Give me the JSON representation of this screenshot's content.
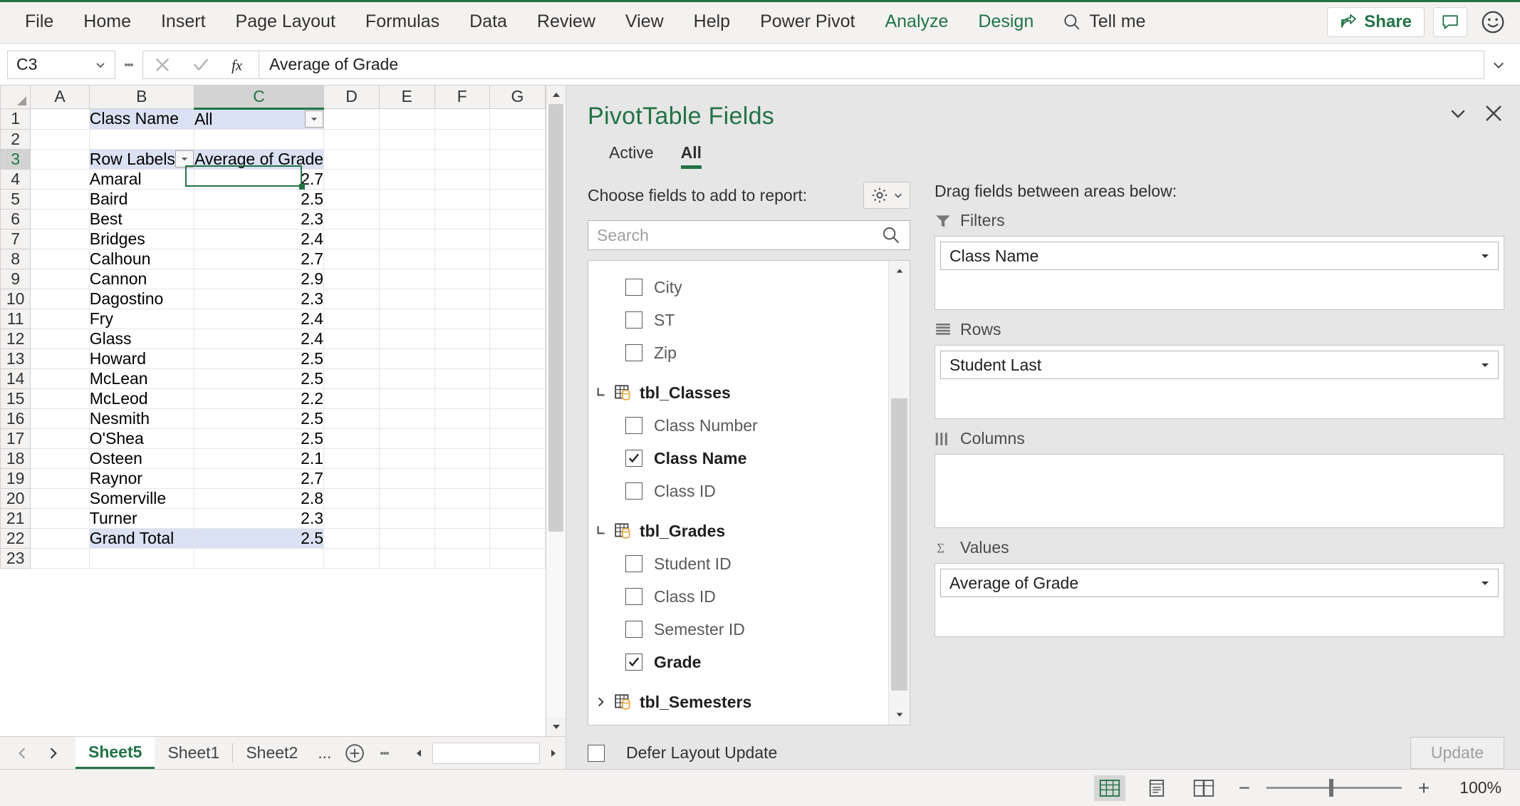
{
  "ribbon": {
    "tabs": [
      {
        "label": "File",
        "contextual": false
      },
      {
        "label": "Home",
        "contextual": false
      },
      {
        "label": "Insert",
        "contextual": false
      },
      {
        "label": "Page Layout",
        "contextual": false
      },
      {
        "label": "Formulas",
        "contextual": false
      },
      {
        "label": "Data",
        "contextual": false
      },
      {
        "label": "Review",
        "contextual": false
      },
      {
        "label": "View",
        "contextual": false
      },
      {
        "label": "Help",
        "contextual": false
      },
      {
        "label": "Power Pivot",
        "contextual": false
      },
      {
        "label": "Analyze",
        "contextual": true
      },
      {
        "label": "Design",
        "contextual": true
      }
    ],
    "tell_me": "Tell me",
    "share": "Share",
    "accent_green": "#217346"
  },
  "formula_bar": {
    "name_box": "C3",
    "cancel_icon": "cancel-x-icon",
    "accept_icon": "check-icon",
    "function_icon": "fx-icon",
    "content": "Average of Grade"
  },
  "grid": {
    "columns": [
      "A",
      "B",
      "C",
      "D",
      "E",
      "F",
      "G"
    ],
    "selected_column": "C",
    "selected_row": "3",
    "rows": [
      {
        "num": "1",
        "b": "Class Name",
        "c": "All",
        "style": "filter",
        "b_drop": false,
        "c_drop": true
      },
      {
        "num": "2",
        "b": "",
        "c": "",
        "style": "empty",
        "b_drop": false,
        "c_drop": false
      },
      {
        "num": "3",
        "b": "Row Labels",
        "c": "Average of Grade",
        "style": "header",
        "b_drop": true,
        "c_drop": false
      },
      {
        "num": "4",
        "b": "Amaral",
        "c": "2.7",
        "style": "data",
        "b_drop": false,
        "c_drop": false
      },
      {
        "num": "5",
        "b": "Baird",
        "c": "2.5",
        "style": "data",
        "b_drop": false,
        "c_drop": false
      },
      {
        "num": "6",
        "b": "Best",
        "c": "2.3",
        "style": "data",
        "b_drop": false,
        "c_drop": false
      },
      {
        "num": "7",
        "b": "Bridges",
        "c": "2.4",
        "style": "data",
        "b_drop": false,
        "c_drop": false
      },
      {
        "num": "8",
        "b": "Calhoun",
        "c": "2.7",
        "style": "data",
        "b_drop": false,
        "c_drop": false
      },
      {
        "num": "9",
        "b": "Cannon",
        "c": "2.9",
        "style": "data",
        "b_drop": false,
        "c_drop": false
      },
      {
        "num": "10",
        "b": "Dagostino",
        "c": "2.3",
        "style": "data",
        "b_drop": false,
        "c_drop": false
      },
      {
        "num": "11",
        "b": "Fry",
        "c": "2.4",
        "style": "data",
        "b_drop": false,
        "c_drop": false
      },
      {
        "num": "12",
        "b": "Glass",
        "c": "2.4",
        "style": "data",
        "b_drop": false,
        "c_drop": false
      },
      {
        "num": "13",
        "b": "Howard",
        "c": "2.5",
        "style": "data",
        "b_drop": false,
        "c_drop": false
      },
      {
        "num": "14",
        "b": "McLean",
        "c": "2.5",
        "style": "data",
        "b_drop": false,
        "c_drop": false
      },
      {
        "num": "15",
        "b": "McLeod",
        "c": "2.2",
        "style": "data",
        "b_drop": false,
        "c_drop": false
      },
      {
        "num": "16",
        "b": "Nesmith",
        "c": "2.5",
        "style": "data",
        "b_drop": false,
        "c_drop": false
      },
      {
        "num": "17",
        "b": "O'Shea",
        "c": "2.5",
        "style": "data",
        "b_drop": false,
        "c_drop": false
      },
      {
        "num": "18",
        "b": "Osteen",
        "c": "2.1",
        "style": "data",
        "b_drop": false,
        "c_drop": false
      },
      {
        "num": "19",
        "b": "Raynor",
        "c": "2.7",
        "style": "data",
        "b_drop": false,
        "c_drop": false
      },
      {
        "num": "20",
        "b": "Somerville",
        "c": "2.8",
        "style": "data",
        "b_drop": false,
        "c_drop": false
      },
      {
        "num": "21",
        "b": "Turner",
        "c": "2.3",
        "style": "data",
        "b_drop": false,
        "c_drop": false
      },
      {
        "num": "22",
        "b": "Grand Total",
        "c": "2.5",
        "style": "total",
        "b_drop": false,
        "c_drop": false
      },
      {
        "num": "23",
        "b": "",
        "c": "",
        "style": "empty",
        "b_drop": false,
        "c_drop": false
      }
    ]
  },
  "sheet_tabs": {
    "tabs": [
      "Sheet5",
      "Sheet1",
      "Sheet2"
    ],
    "active": "Sheet5",
    "overflow": "...",
    "add_icon": "plus-circle-icon"
  },
  "pane": {
    "title": "PivotTable Fields",
    "tabs": [
      {
        "label": "Active",
        "active": false
      },
      {
        "label": "All",
        "active": true
      }
    ],
    "choose_label": "Choose fields to add to report:",
    "search_placeholder": "Search",
    "fields": [
      {
        "label": "City",
        "type": "field",
        "checked": false,
        "indent": 1
      },
      {
        "label": "ST",
        "type": "field",
        "checked": false,
        "indent": 1
      },
      {
        "label": "Zip",
        "type": "field",
        "checked": false,
        "indent": 1
      },
      {
        "label": "tbl_Classes",
        "type": "table",
        "expanded": true
      },
      {
        "label": "Class Number",
        "type": "field",
        "checked": false,
        "indent": 1
      },
      {
        "label": "Class Name",
        "type": "field",
        "checked": true,
        "indent": 1
      },
      {
        "label": "Class ID",
        "type": "field",
        "checked": false,
        "indent": 1
      },
      {
        "label": "tbl_Grades",
        "type": "table",
        "expanded": true
      },
      {
        "label": "Student ID",
        "type": "field",
        "checked": false,
        "indent": 1
      },
      {
        "label": "Class ID",
        "type": "field",
        "checked": false,
        "indent": 1
      },
      {
        "label": "Semester ID",
        "type": "field",
        "checked": false,
        "indent": 1
      },
      {
        "label": "Grade",
        "type": "field",
        "checked": true,
        "indent": 1
      },
      {
        "label": "tbl_Semesters",
        "type": "table",
        "expanded": false
      }
    ],
    "drag_label": "Drag fields between areas below:",
    "zones": [
      {
        "name": "Filters",
        "icon": "filter-funnel-icon",
        "items": [
          "Class Name"
        ]
      },
      {
        "name": "Rows",
        "icon": "rows-icon",
        "items": [
          "Student Last"
        ]
      },
      {
        "name": "Columns",
        "icon": "columns-icon",
        "items": []
      },
      {
        "name": "Values",
        "icon": "sigma-icon",
        "items": [
          "Average of Grade"
        ]
      }
    ],
    "defer_label": "Defer Layout Update",
    "defer_checked": false,
    "update_label": "Update",
    "update_enabled": false
  },
  "status_bar": {
    "views": [
      {
        "name": "normal-view",
        "active": true
      },
      {
        "name": "page-layout-view",
        "active": false
      },
      {
        "name": "page-break-view",
        "active": false
      }
    ],
    "zoom_out": "−",
    "zoom_in": "+",
    "zoom_level": "100%"
  }
}
